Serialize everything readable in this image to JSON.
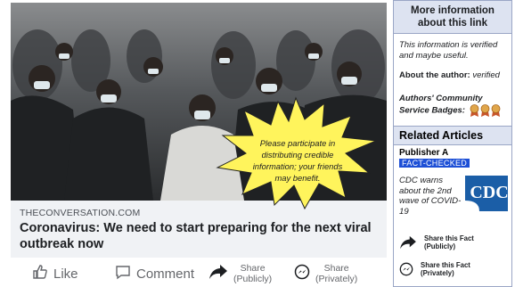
{
  "post": {
    "domain": "THECONVERSATION.COM",
    "headline": "Coronavirus: We need to start preparing for the next viral outbreak now",
    "callout": "Please participate in distributing credible information; your friends may benefit.",
    "actions": {
      "like": "Like",
      "comment": "Comment",
      "share_public_1": "Share",
      "share_public_2": "(Publicly)",
      "share_private_1": "Share",
      "share_private_2": "(Privately)"
    }
  },
  "panel": {
    "header": "More information about this link",
    "verified_text": "This information is verified and maybe useful.",
    "author_label": "About the author:",
    "author_value": "verified",
    "badges_label": "Authors' Community Service Badges:",
    "related_header": "Related Articles",
    "publisher": "Publisher A",
    "fact_checked": "FACT-CHECKED",
    "related_title": "CDC warns about the 2nd wave of COVID-19",
    "cdc_logo_text": "CDC",
    "share_fact_public_1": "Share this Fact",
    "share_fact_public_2": "(Publicly)",
    "share_fact_private_1": "Share this Fact",
    "share_fact_private_2": "(Privately)"
  },
  "colors": {
    "fact_checked_bg": "#1d4fd6",
    "burst_fill": "#fff45c",
    "panel_header_bg": "#dde3f1",
    "cdc_blue": "#1b5ea7"
  }
}
